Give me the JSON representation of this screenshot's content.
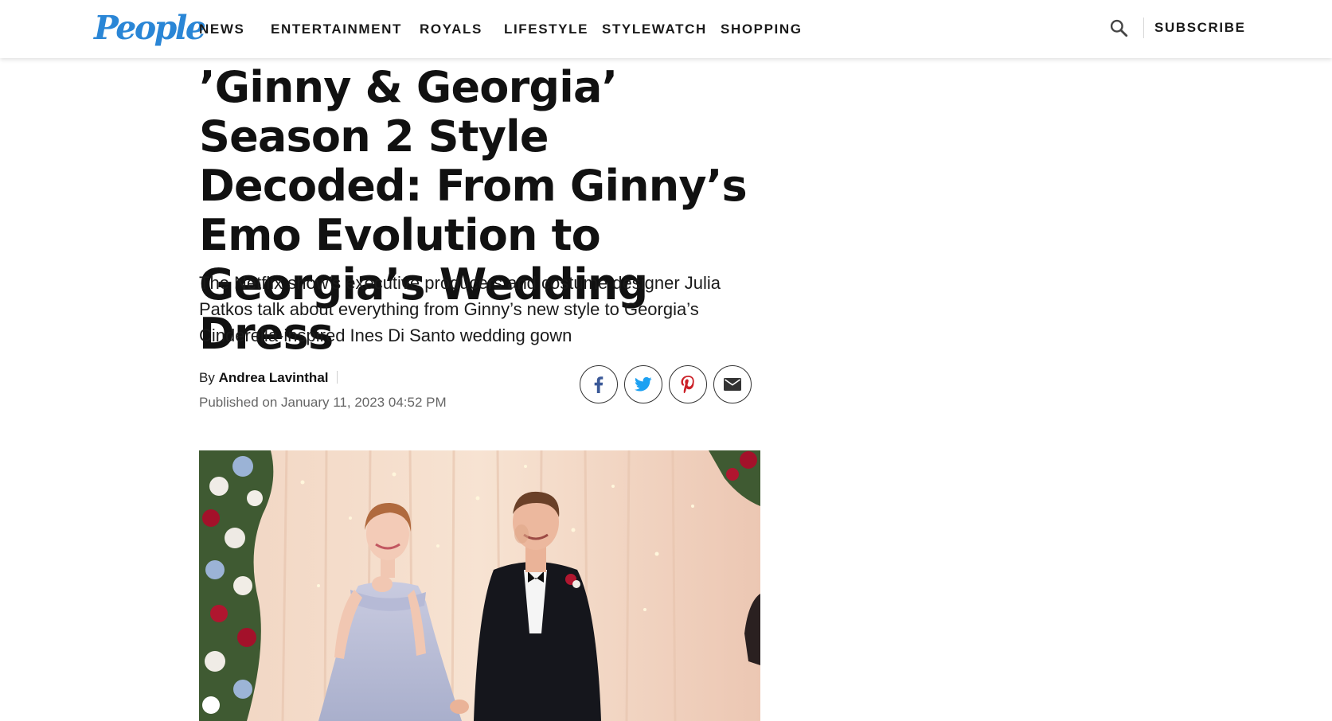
{
  "header": {
    "logo_text": "People",
    "brand_color": "#2a86d6",
    "nav": [
      {
        "label": "NEWS"
      },
      {
        "label": "ENTERTAINMENT"
      },
      {
        "label": "ROYALS"
      },
      {
        "label": "LIFESTYLE"
      },
      {
        "label": "STYLEWATCH"
      },
      {
        "label": "SHOPPING"
      }
    ],
    "search_icon": "search-icon",
    "subscribe_label": "SUBSCRIBE"
  },
  "article": {
    "headline": "’Ginny & Georgia’ Season 2 Style Decoded: From Ginny’s Emo Evolution to Georgia’s Wedding Dress",
    "dek": "The Netflix show’s executive producers and costume designer Julia Patkos talk about everything from Ginny’s new style to Georgia’s Cinderella-inspired Ines Di Santo wedding gown",
    "byline_prefix": "By",
    "author": "Andrea Lavinthal",
    "published": "Published on January 11, 2023 04:52 PM",
    "share": [
      {
        "icon": "facebook-icon",
        "color": "#3b5998"
      },
      {
        "icon": "twitter-icon",
        "color": "#1da1f2"
      },
      {
        "icon": "pinterest-icon",
        "color": "#cb2027"
      },
      {
        "icon": "email-icon",
        "color": "#333333"
      }
    ],
    "hero_image": "wedding-photo"
  }
}
